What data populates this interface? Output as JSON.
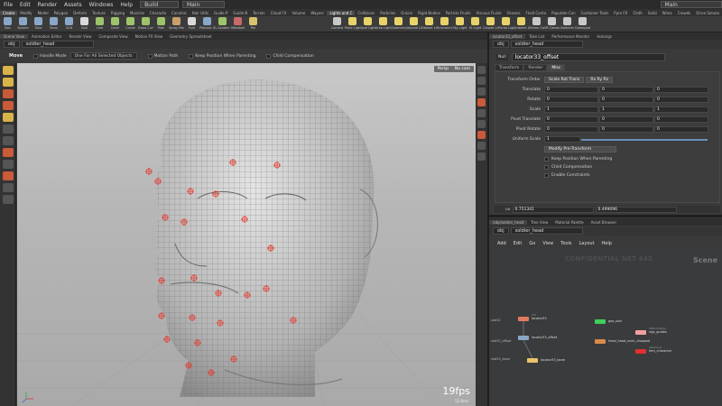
{
  "menubar": {
    "items": [
      "File",
      "Edit",
      "Render",
      "Assets",
      "Windows",
      "Help"
    ],
    "build_label": "Build",
    "desktop_label": "Main",
    "right_desktop_label": "Main"
  },
  "shelf_tabs_left": [
    "Create",
    "Modify",
    "Model",
    "Polygon",
    "Deform",
    "Texture",
    "Rigging",
    "Muscles",
    "Characte",
    "Constrai",
    "Hair Utils",
    "Guide P",
    "Guide B",
    "Terrain",
    "Cloud FX",
    "Volume",
    "Wayerc"
  ],
  "shelf_tabs_right": [
    "Lights and C",
    "Collisions",
    "Particles",
    "Grains",
    "Rigid Bodies",
    "Particle Fluids",
    "Viscous Fluids",
    "Oceans",
    "Fluid Conta",
    "Populate Con",
    "Container Tools",
    "Pyro FX",
    "Cloth",
    "Solid",
    "Wires",
    "Crowds",
    "Drive Simula"
  ],
  "shelf_tools_left": [
    {
      "label": "Box",
      "color": "#8aa7c8"
    },
    {
      "label": "Sphere",
      "color": "#8aa7c8"
    },
    {
      "label": "Tube",
      "color": "#8aa7c8"
    },
    {
      "label": "Torus",
      "color": "#8aa7c8"
    },
    {
      "label": "Grid",
      "color": "#8aa7c8"
    },
    {
      "label": "Null",
      "color": "#d9d9d9"
    },
    {
      "label": "Line",
      "color": "#9ec46a"
    },
    {
      "label": "Circle",
      "color": "#9ec46a"
    },
    {
      "label": "Curve",
      "color": "#9ec46a"
    },
    {
      "label": "Draw Curve",
      "color": "#9ec46a"
    },
    {
      "label": "Path",
      "color": "#9ec46a"
    },
    {
      "label": "Spray Paint",
      "color": "#c89e6a"
    },
    {
      "label": "Font",
      "color": "#d9d9d9"
    },
    {
      "label": "Platonic Solids",
      "color": "#8aa7c8"
    },
    {
      "label": "L-System",
      "color": "#9ec46a"
    },
    {
      "label": "Metaball",
      "color": "#c86a6a"
    },
    {
      "label": "File",
      "color": "#d9c36a"
    }
  ],
  "shelf_tools_right": [
    {
      "label": "Camera",
      "color": "#c8c8c8"
    },
    {
      "label": "Point Light",
      "color": "#e8d36a"
    },
    {
      "label": "Spot Light",
      "color": "#e8d36a"
    },
    {
      "label": "Area Light",
      "color": "#e8d36a"
    },
    {
      "label": "Geometry Light",
      "color": "#e8d36a"
    },
    {
      "label": "Volume Light",
      "color": "#e8d36a"
    },
    {
      "label": "Distant Light",
      "color": "#e8d36a"
    },
    {
      "label": "Environment Light",
      "color": "#e8d36a"
    },
    {
      "label": "Sky Light",
      "color": "#e8d36a"
    },
    {
      "label": "GI Light",
      "color": "#e8d36a"
    },
    {
      "label": "Caustic Light",
      "color": "#e8d36a"
    },
    {
      "label": "Portal Light",
      "color": "#e8d36a"
    },
    {
      "label": "Ambient Light",
      "color": "#e8d36a"
    },
    {
      "label": "Stereo Camera",
      "color": "#c8c8c8"
    },
    {
      "label": "VR Camera",
      "color": "#c8c8c8"
    },
    {
      "label": "Switcher",
      "color": "#c8c8c8"
    },
    {
      "label": "Gamepad Camera",
      "color": "#c8c8c8"
    }
  ],
  "left_pane_tabs": [
    "Scene View",
    "Animation Editor",
    "Render View",
    "Composite View",
    "Motion FX View",
    "Geometry Spreadsheet"
  ],
  "left_path": "obj",
  "left_path_node": "soldier_head",
  "operation_bar": {
    "mode": "Move",
    "handle_mode": "Handle Mode",
    "selection_button": "One For All Selected Objects",
    "options": [
      "Motion Path",
      "Keep Position When Parenting",
      "Child Compensation"
    ]
  },
  "viewport": {
    "persp_label": "Persp",
    "cam_label": "No cam",
    "fps": "19fps",
    "fps_ms": "52.6ms"
  },
  "right_pane_tabs": [
    "locator33_offset",
    "Take List",
    "Performance Monitor",
    "Autorigs"
  ],
  "right_path": "obj",
  "right_path_node": "soldier_head",
  "parameter": {
    "node_type": "Null",
    "node_name": "locator33_offset",
    "tabs": [
      "Transform",
      "Render",
      "Misc"
    ],
    "active_tab": "Misc",
    "transform_order_label": "Transform Order",
    "transform_order_value": "Scale Rot Trans",
    "rotate_order_value": "Rx Ry Rz",
    "rows": [
      {
        "label": "Translate",
        "values": [
          "0",
          "0",
          "0"
        ]
      },
      {
        "label": "Rotate",
        "values": [
          "0",
          "0",
          "0"
        ]
      },
      {
        "label": "Scale",
        "values": [
          "1",
          "1",
          "1"
        ]
      },
      {
        "label": "Pivot Translate",
        "values": [
          "0",
          "0",
          "0"
        ]
      },
      {
        "label": "Pivot Rotate",
        "values": [
          "0",
          "0",
          "0"
        ]
      }
    ],
    "uniform_scale_label": "Uniform Scale",
    "uniform_scale_value": "1",
    "modify_pretransform": "Modify Pre-Transform",
    "checkboxes": [
      "Keep Position When Parenting",
      "Child Compensation",
      "Enable Constraints"
    ],
    "footer_label": "uv",
    "footer_u": "0.751341",
    "footer_v": "0.499096"
  },
  "net_pane_tabs": [
    "/obj/soldier_head",
    "Tree View",
    "Material Palette",
    "Asset Browser"
  ],
  "net_path": "obj",
  "net_path_node": "soldier_head",
  "net_menu": [
    "Add",
    "Edit",
    "Go",
    "View",
    "Tools",
    "Layout",
    "Help"
  ],
  "network": {
    "watermark": "CONFIDENTIAL NET 643",
    "context_label": "Scene",
    "nodes": [
      {
        "name": "locator33",
        "sub": "ctrl",
        "color": "#e07a5f"
      },
      {
        "name": "locator33_offset",
        "sub": "",
        "color": "#8aa7c8"
      },
      {
        "name": "locator33_bone",
        "sub": "",
        "color": "#e8c36a"
      },
      {
        "name": "geo_skin",
        "sub": "",
        "color": "#3fcf5a"
      },
      {
        "name": "rigs_guides",
        "sub": "attachments",
        "color": "#f2a0a0"
      },
      {
        "name": "head_head_neck_chopped",
        "sub": "",
        "color": "#d98a4a"
      },
      {
        "name": "fem_character",
        "sub": "reference",
        "color": "#e03030"
      }
    ],
    "side_labels": [
      "slot32",
      "slot32_offset",
      "slot32_bone"
    ]
  }
}
